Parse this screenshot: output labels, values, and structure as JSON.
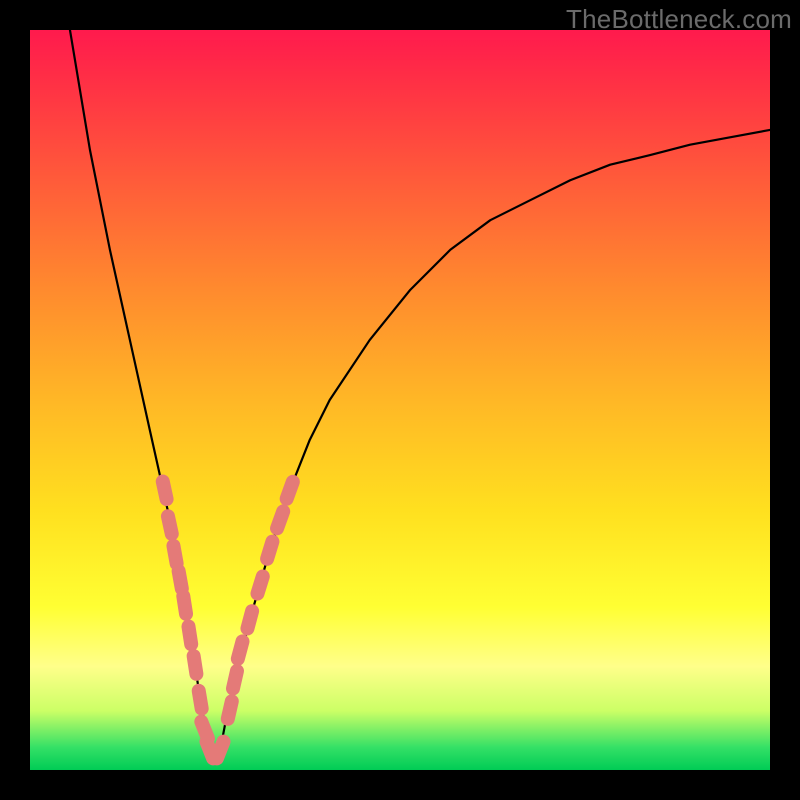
{
  "watermark": "TheBottleneck.com",
  "colors": {
    "curve_stroke": "#000000",
    "marker_fill": "#e47a78",
    "marker_stroke": "#d96a68"
  },
  "chart_data": {
    "type": "line",
    "title": "",
    "xlabel": "",
    "ylabel": "",
    "xlim": [
      0,
      100
    ],
    "ylim": [
      0,
      100
    ],
    "note": "Values are percent of the 740x740 plot area. y=0 is the bottom (green), y=100 is the top (red). The curve has a V-shaped minimum near x≈24.",
    "series": [
      {
        "name": "bottleneck-curve",
        "x": [
          5.4,
          8.1,
          10.8,
          13.5,
          16.2,
          18.9,
          20.3,
          21.6,
          23.0,
          24.3,
          25.7,
          27.0,
          29.7,
          32.4,
          35.1,
          37.8,
          40.5,
          45.9,
          51.4,
          56.8,
          62.2,
          67.6,
          73.0,
          78.4,
          83.8,
          89.2,
          94.6,
          100.0
        ],
        "y": [
          100.0,
          83.8,
          70.3,
          58.1,
          45.9,
          33.8,
          27.0,
          18.9,
          9.5,
          2.7,
          2.7,
          9.5,
          20.3,
          29.7,
          37.8,
          44.6,
          50.0,
          58.1,
          64.9,
          70.3,
          74.3,
          77.0,
          79.7,
          81.8,
          83.1,
          84.5,
          85.5,
          86.5
        ]
      }
    ],
    "markers": {
      "name": "highlighted-points",
      "note": "Salmon capsule/dot markers clustered around the valley of the curve.",
      "points": [
        {
          "x": 18.2,
          "y": 37.8
        },
        {
          "x": 18.9,
          "y": 33.1
        },
        {
          "x": 19.6,
          "y": 29.1
        },
        {
          "x": 20.3,
          "y": 25.7
        },
        {
          "x": 20.9,
          "y": 22.3
        },
        {
          "x": 21.6,
          "y": 18.2
        },
        {
          "x": 22.3,
          "y": 14.2
        },
        {
          "x": 23.0,
          "y": 9.5
        },
        {
          "x": 23.6,
          "y": 5.4
        },
        {
          "x": 24.3,
          "y": 2.7
        },
        {
          "x": 25.7,
          "y": 2.7
        },
        {
          "x": 27.0,
          "y": 8.1
        },
        {
          "x": 27.7,
          "y": 12.2
        },
        {
          "x": 28.4,
          "y": 16.2
        },
        {
          "x": 29.7,
          "y": 20.3
        },
        {
          "x": 31.1,
          "y": 25.0
        },
        {
          "x": 32.4,
          "y": 29.7
        },
        {
          "x": 33.8,
          "y": 33.8
        },
        {
          "x": 35.1,
          "y": 37.8
        }
      ]
    }
  }
}
